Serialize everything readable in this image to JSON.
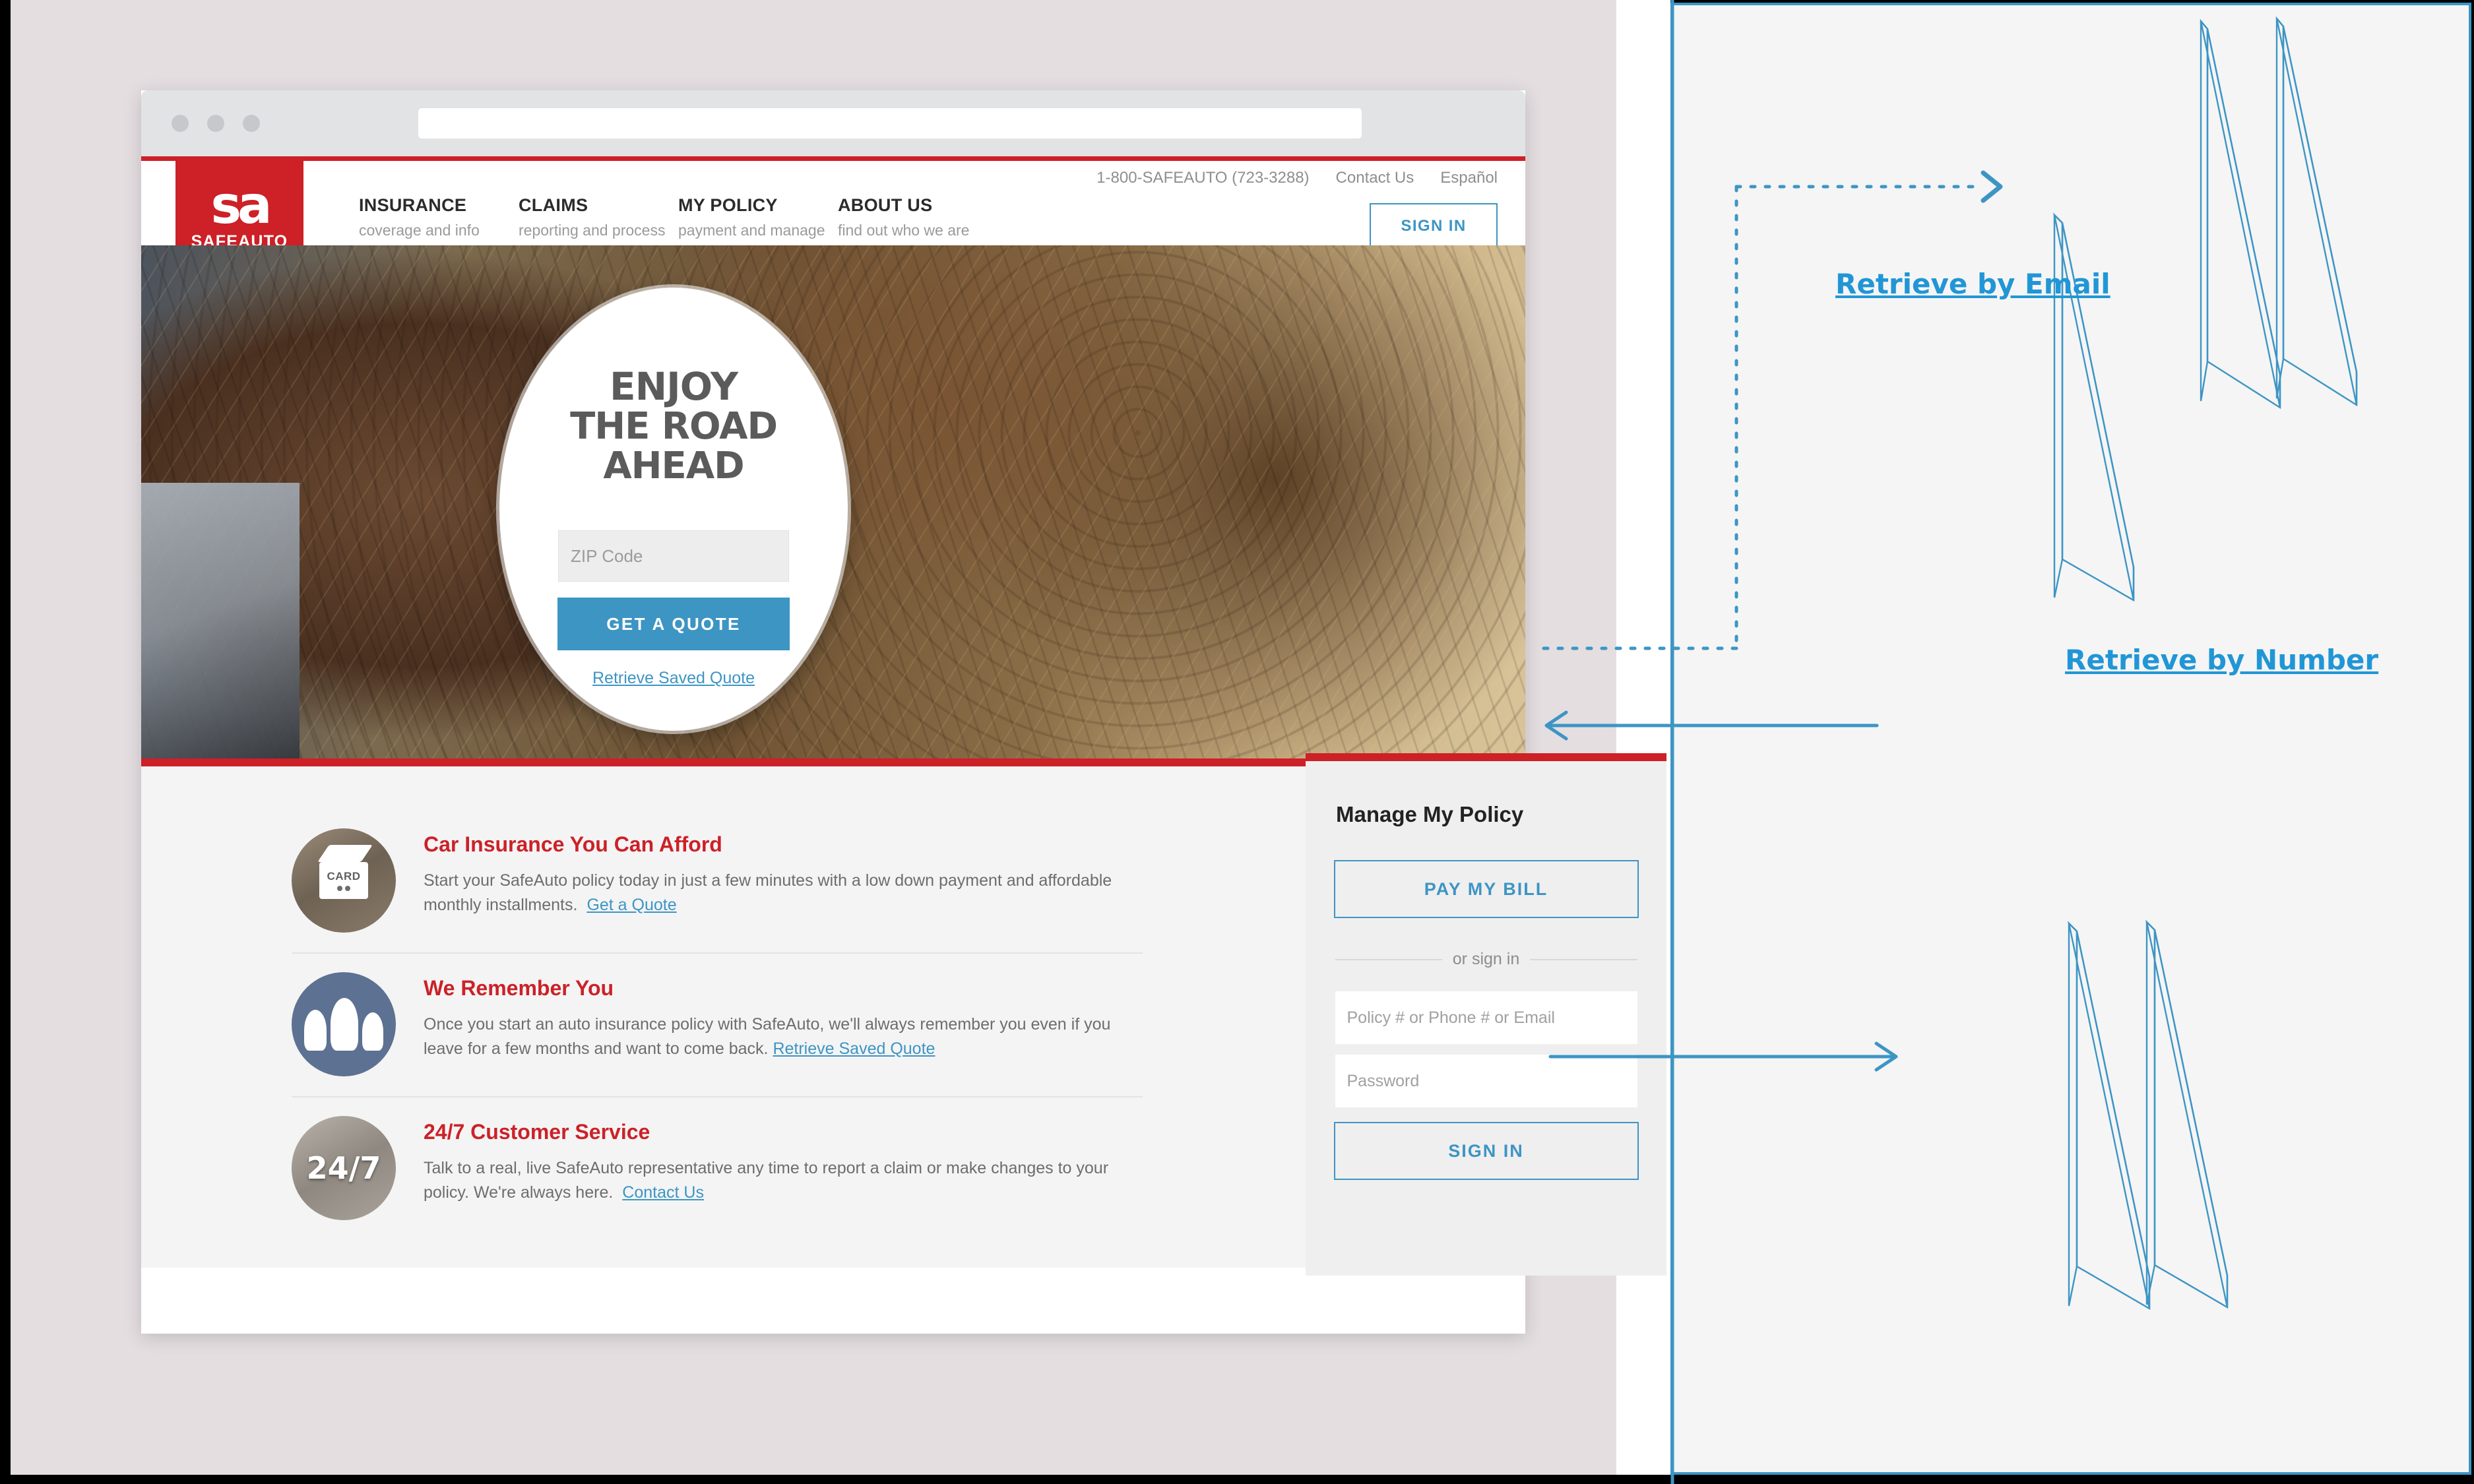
{
  "browser": {
    "window_controls": [
      "close",
      "minimize",
      "maximize"
    ],
    "url_value": "",
    "url_placeholder": ""
  },
  "header": {
    "logo_mark": "sa",
    "logo_word": "SAFEAUTO",
    "utility": {
      "phone": "1-800-SAFEAUTO (723-3288)",
      "contact": "Contact Us",
      "language": "Español"
    },
    "nav": [
      {
        "title": "INSURANCE",
        "sub": "coverage and info"
      },
      {
        "title": "CLAIMS",
        "sub": "reporting and process"
      },
      {
        "title": "MY POLICY",
        "sub": "payment and manage"
      },
      {
        "title": "ABOUT US",
        "sub": "find out who we are"
      }
    ],
    "sign_in": "SIGN IN"
  },
  "hero": {
    "headline_line1": "ENJOY",
    "headline_line2": "THE ROAD AHEAD",
    "zip_placeholder": "ZIP Code",
    "zip_value": "",
    "cta": "GET A QUOTE",
    "retrieve_link": "Retrieve Saved Quote"
  },
  "features": [
    {
      "icon": "credit-card-icon",
      "icon_text": "CARD",
      "title": "Car Insurance You Can Afford",
      "body": "Start your SafeAuto policy today in just a few minutes with a low down payment and affordable monthly installments.",
      "link": "Get a Quote"
    },
    {
      "icon": "people-group-icon",
      "icon_text": "",
      "title": "We Remember You",
      "body": "Once you start an auto insurance policy with SafeAuto, we'll always remember you even if you leave for a few months and want to come back.",
      "link": "Retrieve Saved Quote"
    },
    {
      "icon": "twentyfour-seven-icon",
      "icon_text": "24/7",
      "title": "24/7 Customer Service",
      "body": "Talk to a real, live SafeAuto representative any time to report a claim or make changes to your policy. We're always here.",
      "link": "Contact Us"
    }
  ],
  "sidebar": {
    "title": "Manage My Policy",
    "pay_bill": "PAY MY BILL",
    "divider": "or sign in",
    "identifier_placeholder": "Policy # or Phone # or Email",
    "identifier_value": "",
    "password_placeholder": "Password",
    "password_value": "",
    "sign_in": "SIGN IN"
  },
  "annotations": {
    "label_email": "Retrieve by Email",
    "label_number": "Retrieve by Number",
    "accent_color": "#2196d6"
  },
  "colors": {
    "brand_red": "#cd2027",
    "accent_blue": "#3d95c4",
    "page_background": "#e4dee1",
    "panel_background": "#f5f5f5",
    "content_background": "#f4f4f4",
    "heading_red": "#cc2128"
  }
}
